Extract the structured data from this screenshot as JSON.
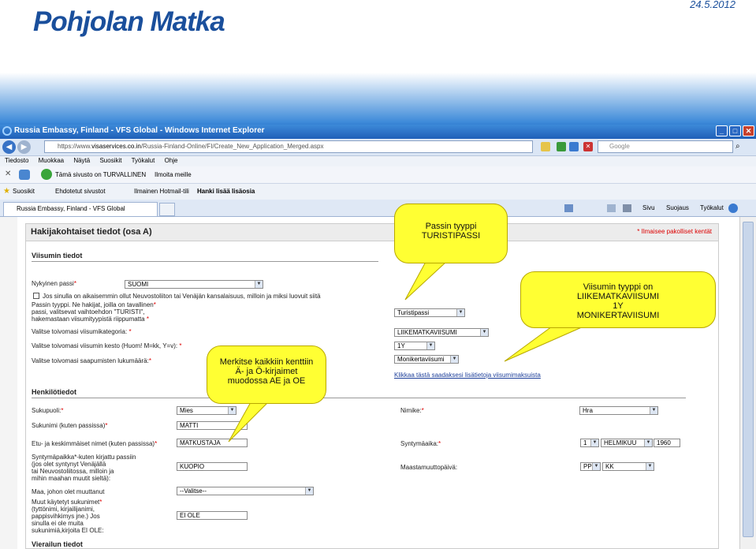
{
  "slide": {
    "logo_text": "Pohjolan Matka",
    "date": "24.5.2012"
  },
  "browser": {
    "window_title": "Russia Embassy, Finland - VFS Global - Windows Internet Explorer",
    "address_prefix": "https://www.",
    "address_domain": "visaservices.co.in",
    "address_rest": "/Russia-Finland-Online/FI/Create_New_Application_Merged.aspx",
    "search_placeholder": "Google",
    "menu": [
      "Tiedosto",
      "Muokkaa",
      "Näytä",
      "Suosikit",
      "Työkalut",
      "Ohje"
    ],
    "toolbar_tracking": "Tämä sivusto on TURVALLINEN",
    "toolbar_report": "Ilmoita meille",
    "fav_label": "Suosikit",
    "fav_suggested": "Ehdotetut sivustot",
    "fav_hotmail": "Ilmainen Hotmail-tili",
    "fav_addons": "Hanki lisää lisäosia",
    "tab_label": "Russia Embassy, Finland - VFS Global",
    "cmd_page": "Sivu",
    "cmd_safety": "Suojaus",
    "cmd_tools": "Työkalut"
  },
  "form": {
    "header": "Hakijakohtaiset tiedot (osa A)",
    "required_note": "Ilmaisee pakolliset kentät",
    "visa_section": "Viisumin tiedot",
    "current_passport_label": "Nykyinen passi",
    "current_passport_value": "SUOMI",
    "soviet_checkbox_label": "Jos sinulla on aikaisemmin ollut Neuvostoliiton tai Venäjän kansalaisuus, milloin ja miksi luovuit siitä",
    "passport_type_label_1": "Passin tyyppi. Ne hakijat, joilla on tavallinen",
    "passport_type_label_2": "passi, valitsevat vaihtoehdon \"TURISTI\",",
    "passport_type_label_3": "hakemastaan viisumityypistä riippumatta",
    "passport_type_value": "Turistipassi",
    "visa_category_label": "Valitse toivomasi viisumikategoria:",
    "visa_category_value": "LIIKEMATKAVIISUMI",
    "visa_duration_label": "Valitse toivomasi viisumin kesto (Huom! M=kk, Y=v):",
    "visa_duration_value": "1Y",
    "entries_label": "Valitse toivomasi saapumisten lukumäärä:",
    "entries_value": "Monikertaviisumi",
    "fees_link": "Klikkaa tästä saadaksesi lisätietoja viisumimaksuista",
    "person_section": "Henkilötiedot",
    "gender_label": "Sukupuoli:",
    "gender_value": "Mies",
    "title_label": "Nimike:",
    "title_value": "Hra",
    "surname_label": "Sukunimi (kuten passissa)",
    "surname_value": "MATTI",
    "firstnames_label": "Etu- ja keskimmäiset nimet (kuten passissa)",
    "firstnames_value": "MATKUSTAJA",
    "dob_label": "Syntymäaika:",
    "dob_day": "1",
    "dob_month": "HELMIKUU",
    "dob_year": "1960",
    "birthplace_label_1": "Syntymäpaikka*-kuten kirjattu passiin",
    "birthplace_label_2": "(jos olet syntynyt Venäjällä",
    "birthplace_label_3": "tai Neuvostoliitossa, milloin ja",
    "birthplace_label_4": "mihin maahan muutit sieltä):",
    "birthplace_value": "KUOPIO",
    "emigration_label": "Maastamuuttopäivä:",
    "emigration_day": "PP",
    "emigration_month": "KK",
    "country_label": "Maa, johon olet muuttanut",
    "country_value": "--Valitse--",
    "other_names_label_1": "Muut käytetyt sukunimet",
    "other_names_label_2": "(tyttönimi, kirjailijanimi,",
    "other_names_label_3": "pappisvihkimys jne.) Jos",
    "other_names_label_4": "sinulla ei ole muita",
    "other_names_label_5": "sukunimiä,kirjoita EI OLE:",
    "other_names_value": "EI OLE",
    "visit_section": "Vierailun tiedot"
  },
  "callouts": {
    "passport": [
      "Passin tyyppi",
      "TURISTIPASSI"
    ],
    "visa_type": [
      "Viisumin tyyppi on",
      "LIIKEMATKAVIISUMI",
      "1Y",
      "MONIKERTAVIISUMI"
    ],
    "letters": [
      "Merkitse kaikkiin kenttiin",
      "Ä- ja Ö-kirjaimet",
      "muodossa AE ja OE"
    ]
  },
  "colors": {
    "brand": "#1a4f9c",
    "callout": "#ffff33",
    "required": "#dd0000"
  }
}
